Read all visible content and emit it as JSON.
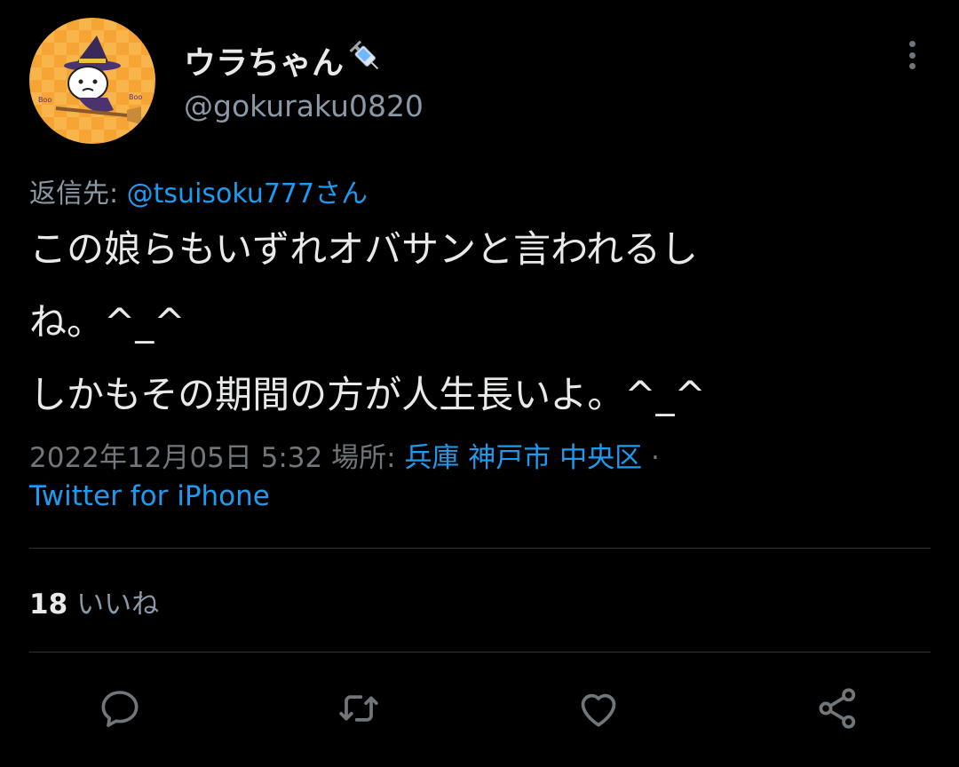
{
  "header": {
    "display_name": "ウラちゃん",
    "name_emoji": "syringe-icon",
    "handle": "@gokuraku0820"
  },
  "reply": {
    "prefix": "返信先: ",
    "to": "@tsuisoku777さん"
  },
  "tweet": {
    "lines": [
      "この娘らもいずれオバサンと言われるし",
      "ね。^_^",
      "しかもその期間の方が人生長いよ。^_^"
    ]
  },
  "meta": {
    "timestamp": "2022年12月05日 5:32 ",
    "location_label": "場所: ",
    "location": "兵庫 神戸市 中央区",
    "separator": " ·",
    "source": "Twitter for iPhone"
  },
  "stats": {
    "likes_count": "18",
    "likes_label": "いいね"
  },
  "actions": [
    "reply-icon",
    "retweet-icon",
    "like-icon",
    "share-icon"
  ],
  "colors": {
    "background": "#000000",
    "link": "#1d9bf0",
    "secondary_text": "#8b98a5",
    "icon": "#71767b",
    "divider": "#2f3336"
  }
}
